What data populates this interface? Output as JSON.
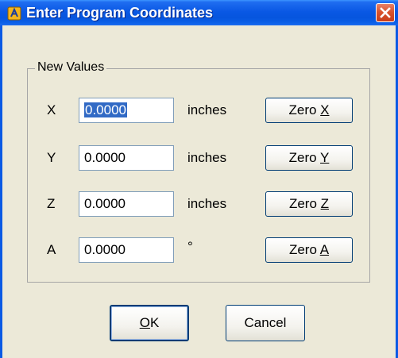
{
  "window": {
    "title": "Enter Program Coordinates"
  },
  "group": {
    "legend": "New Values"
  },
  "rows": [
    {
      "axis": "X",
      "value": "0.0000",
      "unit": "inches",
      "zero_prefix": "Zero ",
      "zero_key": "X"
    },
    {
      "axis": "Y",
      "value": "0.0000",
      "unit": "inches",
      "zero_prefix": "Zero ",
      "zero_key": "Y"
    },
    {
      "axis": "Z",
      "value": "0.0000",
      "unit": "inches",
      "zero_prefix": "Zero ",
      "zero_key": "Z"
    },
    {
      "axis": "A",
      "value": "0.0000",
      "unit": "°",
      "zero_prefix": "Zero ",
      "zero_key": "A"
    }
  ],
  "buttons": {
    "ok_key": "O",
    "ok_rest": "K",
    "cancel": "Cancel"
  },
  "colors": {
    "titlebar": "#0a58e4",
    "dialog_bg": "#ece9d8",
    "selection": "#316ac5",
    "close_button": "#d9542e"
  }
}
